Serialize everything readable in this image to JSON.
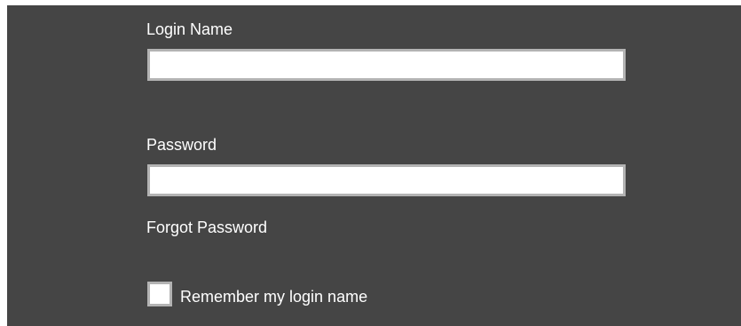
{
  "form": {
    "login_name_label": "Login Name",
    "login_name_value": "",
    "password_label": "Password",
    "password_value": "",
    "forgot_password_label": "Forgot Password",
    "remember_label": "Remember my login name",
    "remember_checked": false
  },
  "colors": {
    "panel_background": "#454545",
    "page_background": "#ffffff",
    "field_background": "#ffffff",
    "field_border": "#b3b3b3",
    "text": "#ffffff"
  }
}
